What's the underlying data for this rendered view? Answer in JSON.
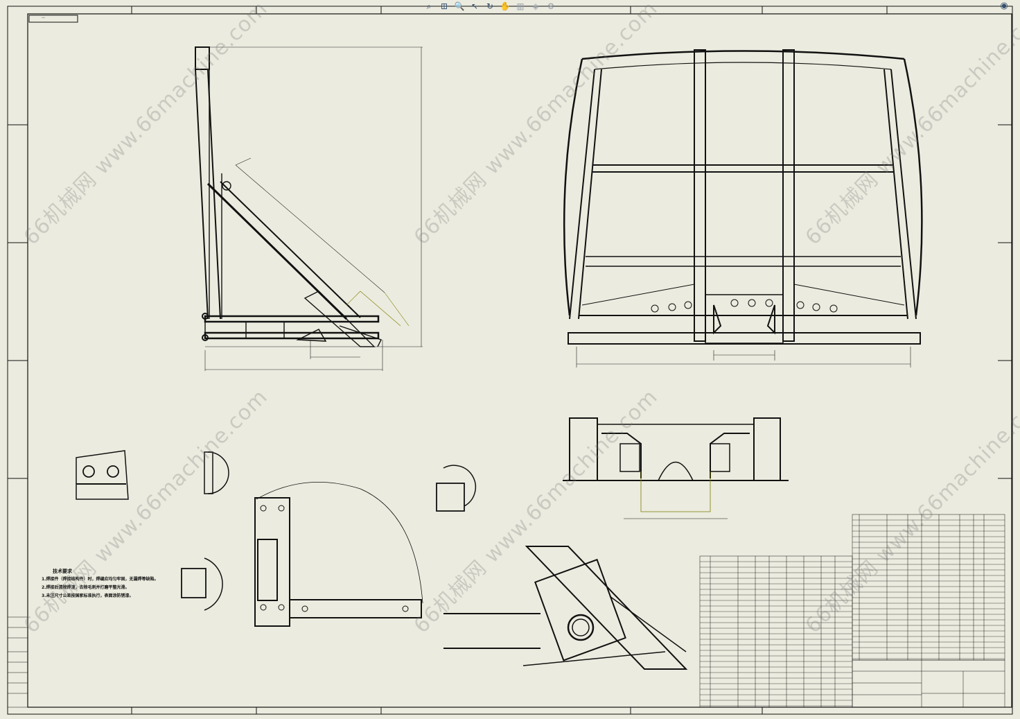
{
  "toolbar": {
    "tools": [
      {
        "icon": "zoom-to-fit-icon",
        "glyph": "⌕"
      },
      {
        "icon": "zoom-area-icon",
        "glyph": "⊞"
      },
      {
        "icon": "zoom-icon",
        "glyph": "🔍"
      },
      {
        "icon": "select-icon",
        "glyph": "↖"
      },
      {
        "icon": "rotate-icon",
        "glyph": "↻"
      },
      {
        "icon": "pan-icon",
        "glyph": "✋"
      },
      {
        "icon": "display-style-icon",
        "glyph": "▥"
      },
      {
        "icon": "view-orientation-icon",
        "glyph": "◈"
      },
      {
        "icon": "hide-show-icon",
        "glyph": "⚙"
      }
    ],
    "right_tool": {
      "icon": "view-settings-icon",
      "glyph": "◉"
    }
  },
  "watermark": {
    "text": "66机械网 www.66machine.com"
  },
  "notes": {
    "title": "技术要求",
    "lines": [
      "1.焊接件（焊接结构件）时，焊缝应均匀牢固，无漏焊等缺陷。",
      "2.焊接后清除焊渣，去除毛刺并打磨平整光滑。",
      "3.未注尺寸公差按国家标准执行，表面涂防锈漆。"
    ]
  }
}
